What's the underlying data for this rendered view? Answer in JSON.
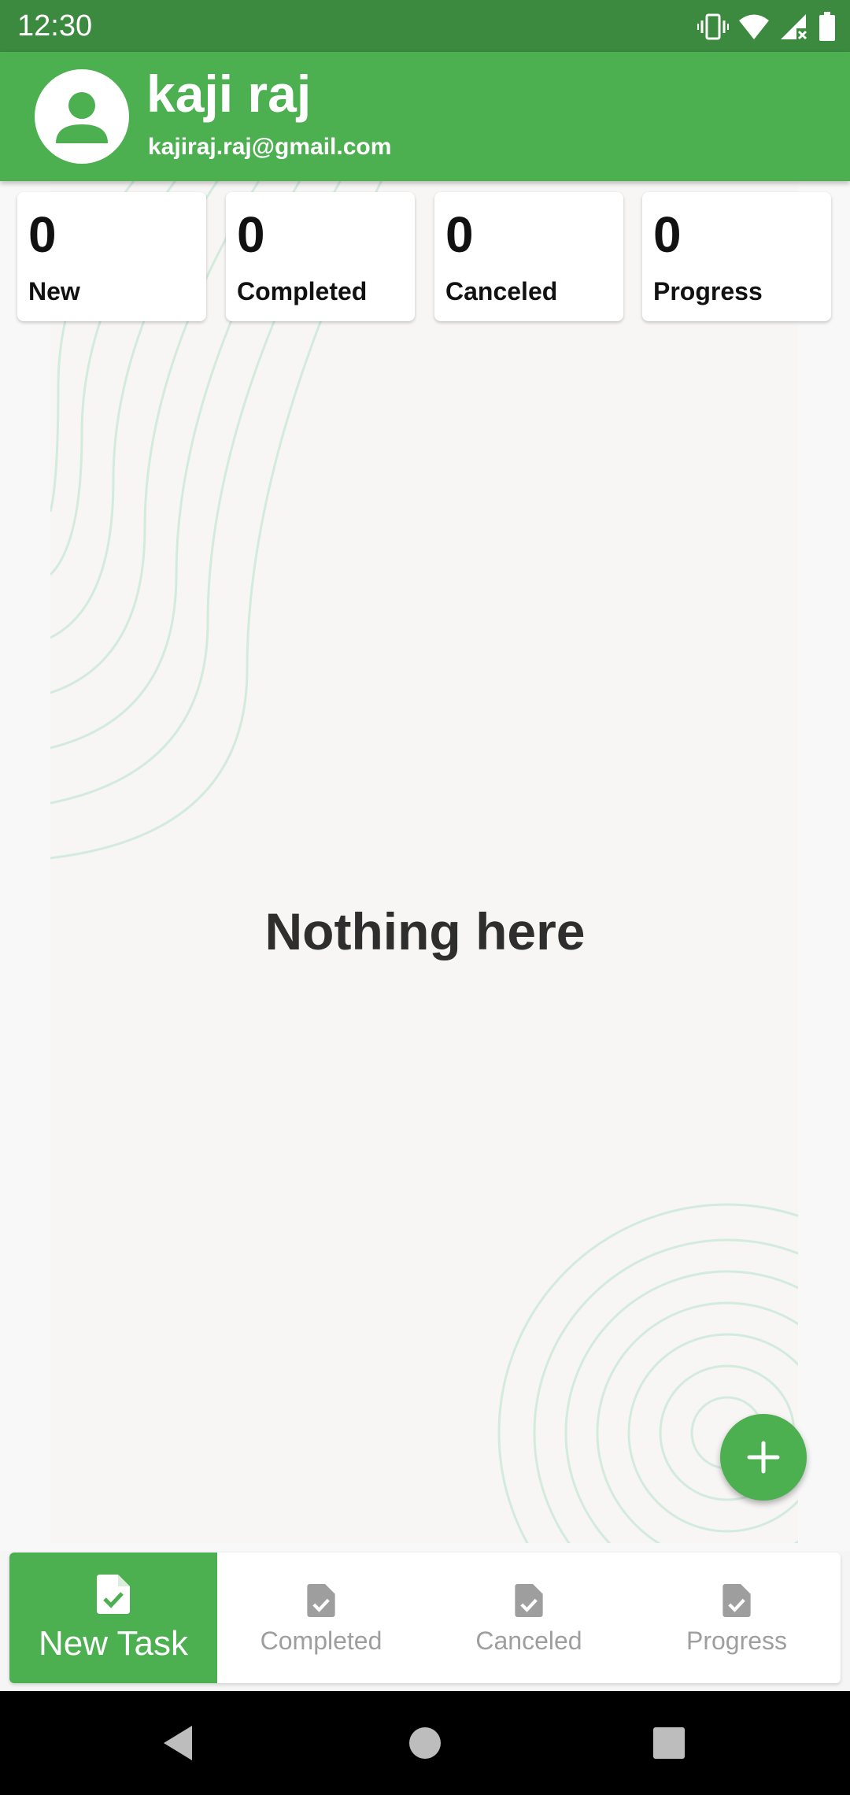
{
  "status_bar": {
    "time": "12:30",
    "icons": [
      "vibrate-icon",
      "wifi-icon",
      "signal-icon",
      "battery-icon"
    ]
  },
  "header": {
    "avatar_icon": "person-icon",
    "user_name": "kaji raj",
    "user_email": "kajiraj.raj@gmail.com"
  },
  "summary_cards": [
    {
      "count": "0",
      "label": "New"
    },
    {
      "count": "0",
      "label": "Completed"
    },
    {
      "count": "0",
      "label": "Canceled"
    },
    {
      "count": "0",
      "label": "Progress"
    }
  ],
  "main": {
    "empty_message": "Nothing here"
  },
  "fab": {
    "icon": "plus-icon"
  },
  "bottom_nav": {
    "items": [
      {
        "label": "New Task",
        "icon": "task-document-icon",
        "active": true
      },
      {
        "label": "Completed",
        "icon": "task-document-icon",
        "active": false
      },
      {
        "label": "Canceled",
        "icon": "task-document-icon",
        "active": false
      },
      {
        "label": "Progress",
        "icon": "task-document-icon",
        "active": false
      }
    ]
  },
  "system_nav": {
    "icons": [
      "back-icon",
      "home-icon",
      "recents-icon"
    ]
  },
  "colors": {
    "primary": "#4caf50",
    "status_bar": "#3b8a3f",
    "inactive_nav": "#9e9e9e",
    "text_dark": "#2e2e2e"
  }
}
